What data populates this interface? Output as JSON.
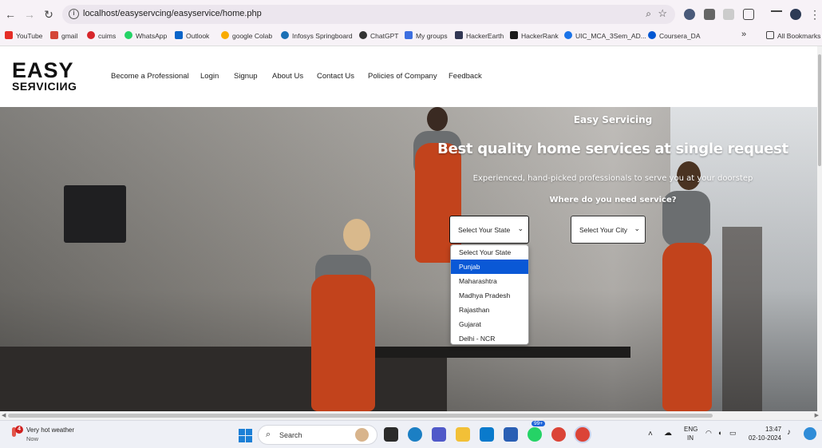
{
  "browser": {
    "url": "localhost/easyservcing/easyservice/home.php",
    "bookmarks": [
      {
        "label": "YouTube",
        "color": "#e52d27"
      },
      {
        "label": "gmail",
        "color": "#d44638"
      },
      {
        "label": "cuims",
        "color": "#d7262b"
      },
      {
        "label": "WhatsApp",
        "color": "#25d366"
      },
      {
        "label": "Outlook",
        "color": "#0a64c9"
      },
      {
        "label": "google Colab",
        "color": "#f9ab00"
      },
      {
        "label": "Infosys Springboard",
        "color": "#1b6fb5"
      },
      {
        "label": "ChatGPT",
        "color": "#333333"
      },
      {
        "label": "My groups",
        "color": "#3d6fe0"
      },
      {
        "label": "HackerEarth",
        "color": "#323754"
      },
      {
        "label": "HackerRank",
        "color": "#1b1b1b"
      },
      {
        "label": "UIC_MCA_3Sem_AD...",
        "color": "#1a73e8"
      },
      {
        "label": "Coursera_DA",
        "color": "#0056d2"
      }
    ],
    "more": "»",
    "all_bookmarks": "All Bookmarks"
  },
  "site": {
    "logo_line1": "EASY",
    "logo_line2": "SEЯVICIИG",
    "nav": [
      "Become a Professional",
      "Login",
      "Signup",
      "About Us",
      "Contact Us",
      "Policies of Company",
      "Feedback"
    ]
  },
  "hero": {
    "brand": "Easy Servicing",
    "title": "Best quality home services at single request",
    "subtitle": "Experienced, hand-picked professionals to serve you at your doorstep",
    "question": "Where do you need service?",
    "state_select": "Select Your State",
    "city_select": "Select Your City",
    "state_options": [
      "Select Your State",
      "Punjab",
      "Maharashtra",
      "Madhya Pradesh",
      "Rajasthan",
      "Gujarat",
      "Delhi - NCR"
    ],
    "highlighted_option": "Punjab"
  },
  "taskbar": {
    "weather_title": "Very hot weather",
    "weather_sub": "Now",
    "weather_badge": "4",
    "search": "Search",
    "lang1": "ENG",
    "lang2": "IN",
    "time": "13:47",
    "date": "02-10-2024",
    "badge_count": "99+"
  },
  "colors": {
    "accent_selected": "#0a58d6",
    "hero_text": "#ffffff",
    "orange_uniform": "#c2431c"
  }
}
